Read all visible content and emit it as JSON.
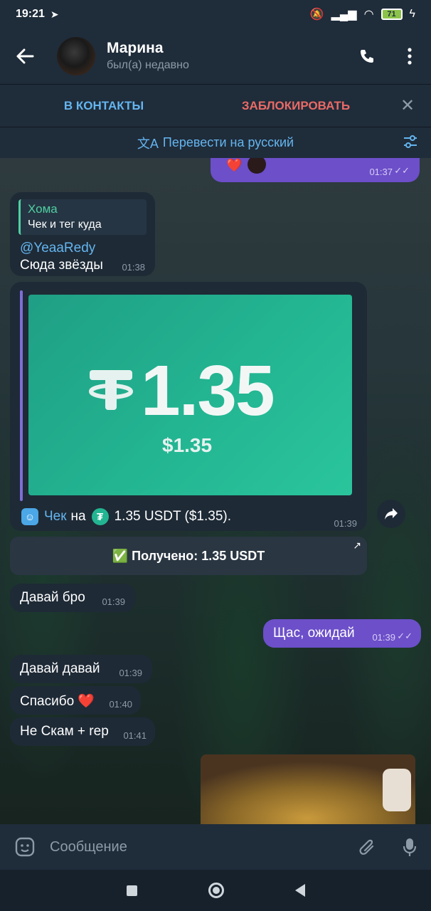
{
  "status_bar": {
    "time": "19:21",
    "battery": "71"
  },
  "header": {
    "name": "Марина",
    "status": "был(а) недавно"
  },
  "actions": {
    "add_contact": "В КОНТАКТЫ",
    "block": "ЗАБЛОКИРОВАТЬ"
  },
  "translate": {
    "label": "Перевести на русский"
  },
  "messages": {
    "top_out_time": "01:37",
    "reply": {
      "quote_author": "Хома",
      "quote_text": "Чек и тег куда",
      "mention": "@YeaaRedy",
      "text": "Сюда звёзды",
      "time": "01:38"
    },
    "check": {
      "big_amount": "1.35",
      "usd_amount": "$1.35",
      "caption_link": "Чек",
      "caption_mid": "на",
      "caption_value": "1.35 USDT ($1.35).",
      "time": "01:39",
      "received": "✅ Получено: 1.35 USDT"
    },
    "m1": {
      "text": "Давай бро",
      "time": "01:39"
    },
    "m2": {
      "text": "Щас, ожидай",
      "time": "01:39"
    },
    "m3": {
      "text": "Давай давай",
      "time": "01:39"
    },
    "m4": {
      "text": "Спасибо",
      "emoji": "❤️",
      "time": "01:40"
    },
    "m5": {
      "text": "Не Скам + rep",
      "time": "01:41"
    }
  },
  "composer": {
    "placeholder": "Сообщение"
  },
  "colors": {
    "accent": "#64b5ef",
    "danger": "#e96a66",
    "outgoing": "#6c4fc9",
    "incoming": "#1e2a36",
    "usdt": "#23b592"
  }
}
